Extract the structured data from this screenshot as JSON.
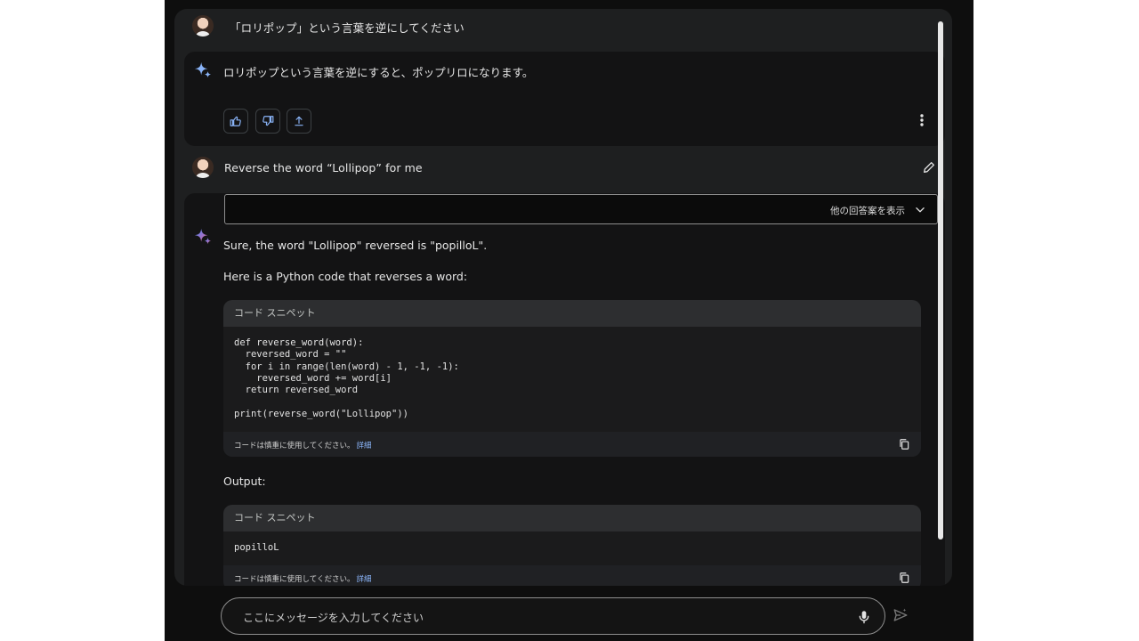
{
  "conversation": {
    "turn1": {
      "prompt": "「ロリポップ」という言葉を逆にしてください",
      "response": "ロリポップという言葉を逆にすると、ポップリロになります。"
    },
    "turn2": {
      "prompt": "Reverse the word “Lollipop” for me",
      "drafts_label": "他の回答案を表示",
      "response_intro": "Sure, the word \"Lollipop\" reversed is \"popilloL\".",
      "response_para": "Here is a Python code that reverses a word:",
      "output_label": "Output:",
      "code_blocks": [
        {
          "header": "コード スニペット",
          "lines": [
            "def reverse_word(word):",
            "  reversed_word = \"\"",
            "  for i in range(len(word) - 1, -1, -1):",
            "    reversed_word += word[i]",
            "  return reversed_word",
            "",
            "print(reverse_word(\"Lollipop\"))"
          ],
          "footer_note": "コードは慎重に使用してください。",
          "footer_link": "詳細"
        },
        {
          "header": "コード スニペット",
          "lines": [
            "popilloL"
          ],
          "footer_note": "コードは慎重に使用してください。",
          "footer_link": "詳細"
        }
      ]
    }
  },
  "input": {
    "placeholder": "ここにメッセージを入力してください"
  },
  "icons": {
    "thumbs_up": "thumbs-up-icon",
    "thumbs_down": "thumbs-down-icon",
    "share": "share-icon",
    "more": "more-vert-icon",
    "edit": "edit-icon",
    "chevron": "chevron-down-icon",
    "copy": "copy-icon",
    "mic": "mic-icon",
    "send": "send-icon",
    "sparkle": "sparkle-icon"
  },
  "colors": {
    "accent_link": "#8ab4f8",
    "sparkle_blue": "#4b8df8",
    "sparkle_red": "#d96570"
  }
}
